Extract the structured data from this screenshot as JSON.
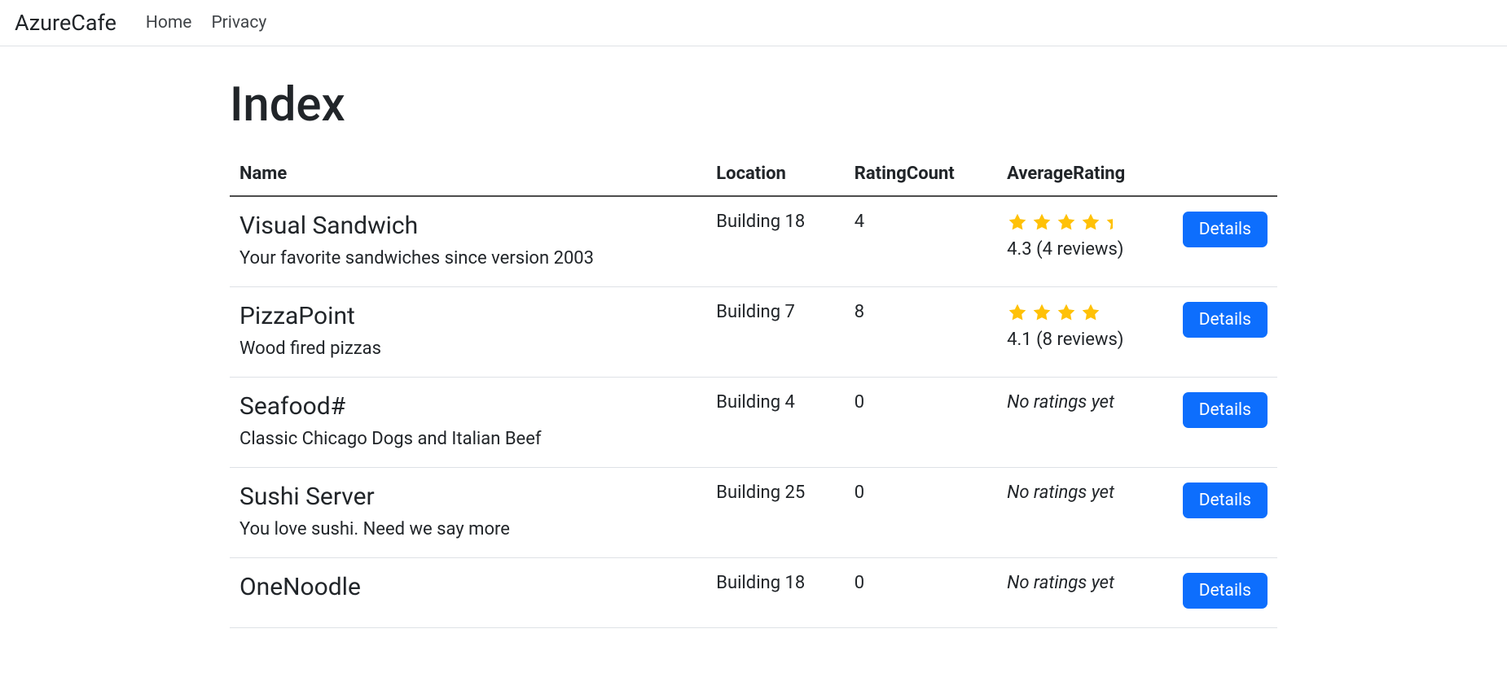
{
  "nav": {
    "brand": "AzureCafe",
    "links": [
      {
        "label": "Home"
      },
      {
        "label": "Privacy"
      }
    ]
  },
  "pageTitle": "Index",
  "table": {
    "headers": {
      "name": "Name",
      "location": "Location",
      "ratingCount": "RatingCount",
      "averageRating": "AverageRating"
    },
    "rows": [
      {
        "name": "Visual Sandwich",
        "desc": "Your favorite sandwiches since version 2003",
        "location": "Building 18",
        "ratingCount": "4",
        "hasRating": true,
        "stars": 4,
        "showPartial": true,
        "ratingText": "4.3 (4 reviews)",
        "detailsLabel": "Details"
      },
      {
        "name": "PizzaPoint",
        "desc": "Wood fired pizzas",
        "location": "Building 7",
        "ratingCount": "8",
        "hasRating": true,
        "stars": 4,
        "showPartial": false,
        "ratingText": "4.1 (8 reviews)",
        "detailsLabel": "Details"
      },
      {
        "name": "Seafood#",
        "desc": "Classic Chicago Dogs and Italian Beef",
        "location": "Building 4",
        "ratingCount": "0",
        "hasRating": false,
        "noRatingText": "No ratings yet",
        "detailsLabel": "Details"
      },
      {
        "name": "Sushi Server",
        "desc": "You love sushi. Need we say more",
        "location": "Building 25",
        "ratingCount": "0",
        "hasRating": false,
        "noRatingText": "No ratings yet",
        "detailsLabel": "Details"
      },
      {
        "name": "OneNoodle",
        "desc": "",
        "location": "Building 18",
        "ratingCount": "0",
        "hasRating": false,
        "noRatingText": "No ratings yet",
        "detailsLabel": "Details"
      }
    ]
  },
  "colors": {
    "primary": "#0d6efd",
    "star": "#ffc107"
  }
}
